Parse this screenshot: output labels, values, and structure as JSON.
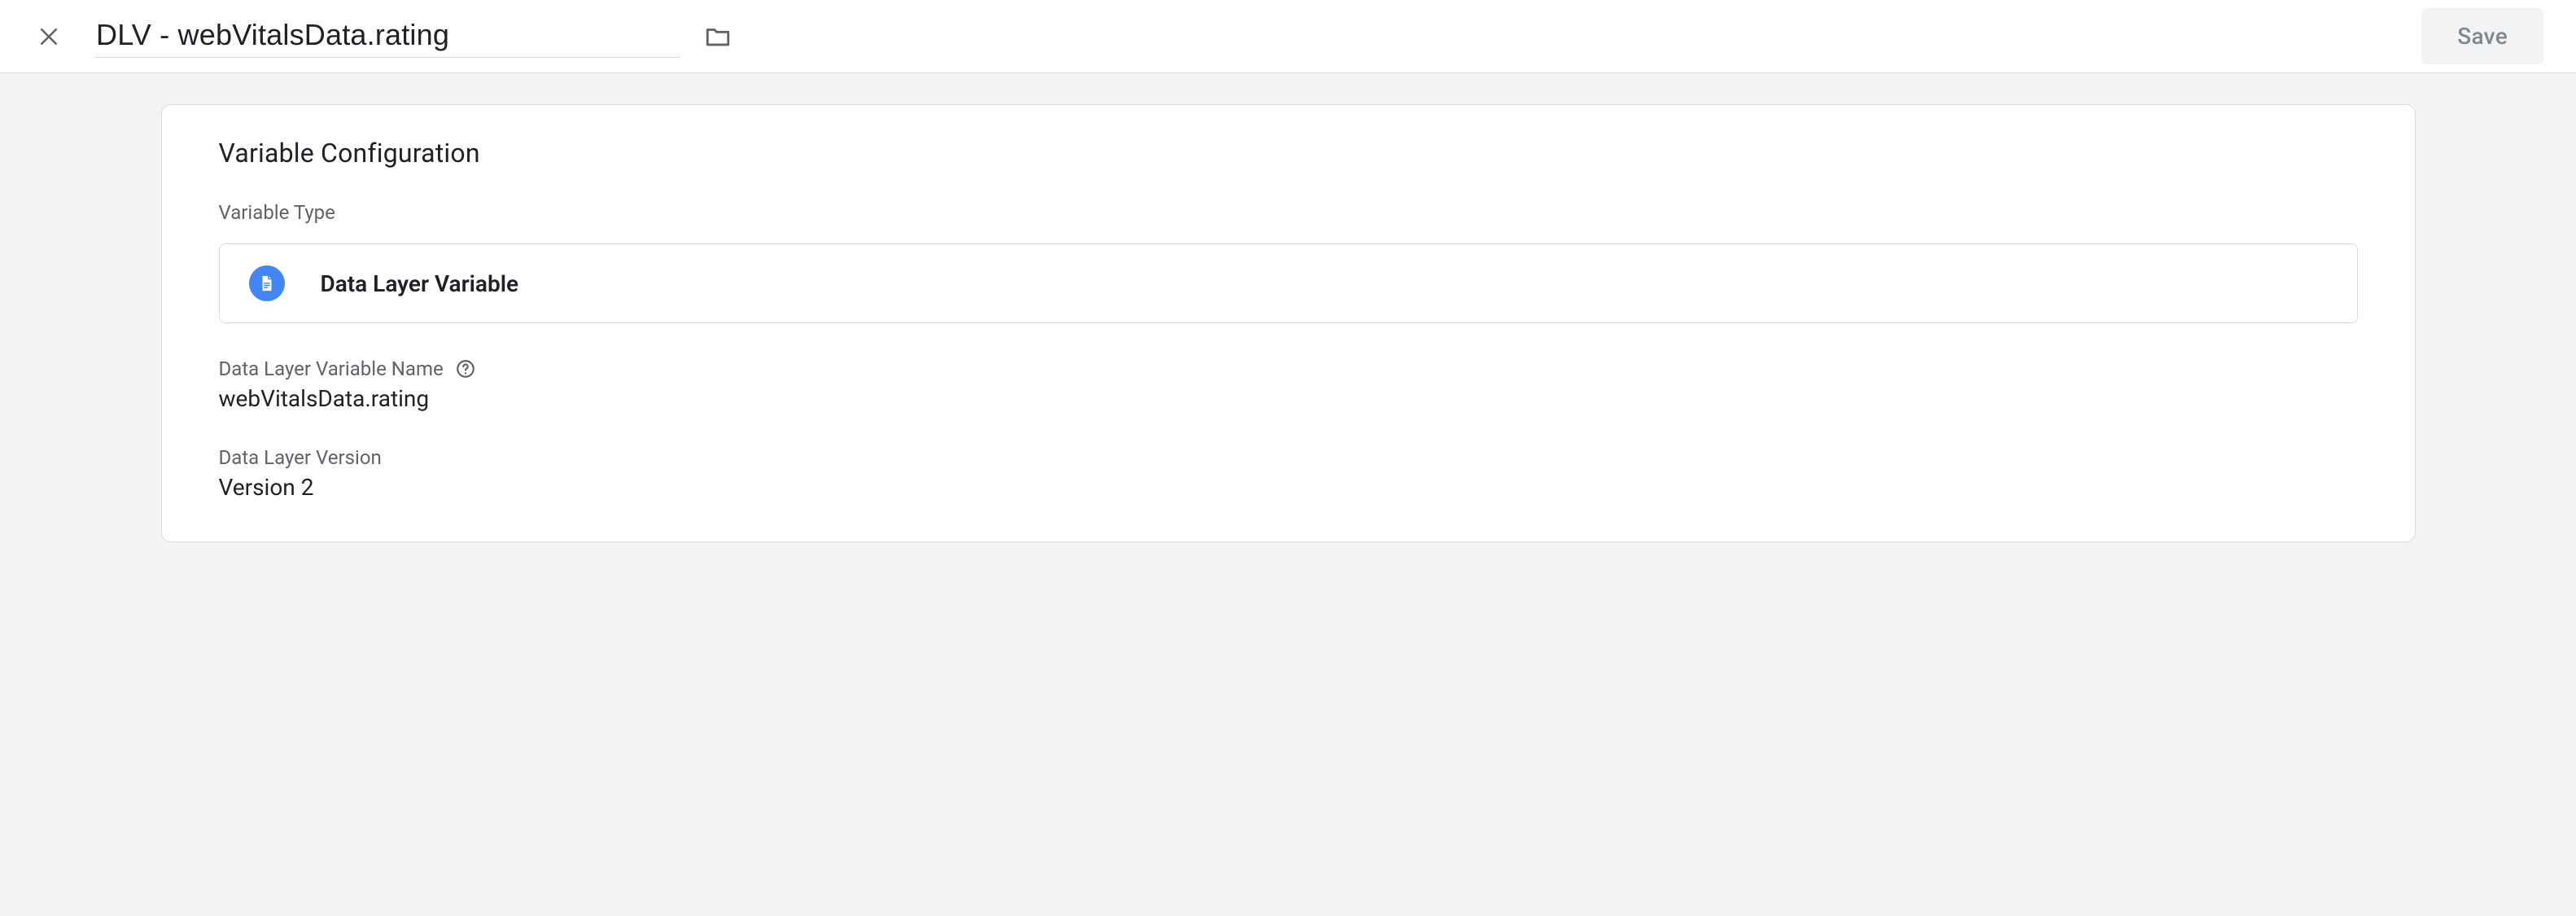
{
  "header": {
    "title": "DLV - webVitalsData.rating",
    "save_label": "Save"
  },
  "card": {
    "title": "Variable Configuration",
    "variable_type": {
      "label": "Variable Type",
      "value": "Data Layer Variable"
    },
    "variable_name": {
      "label": "Data Layer Variable Name",
      "value": "webVitalsData.rating"
    },
    "version": {
      "label": "Data Layer Version",
      "value": "Version 2"
    }
  }
}
